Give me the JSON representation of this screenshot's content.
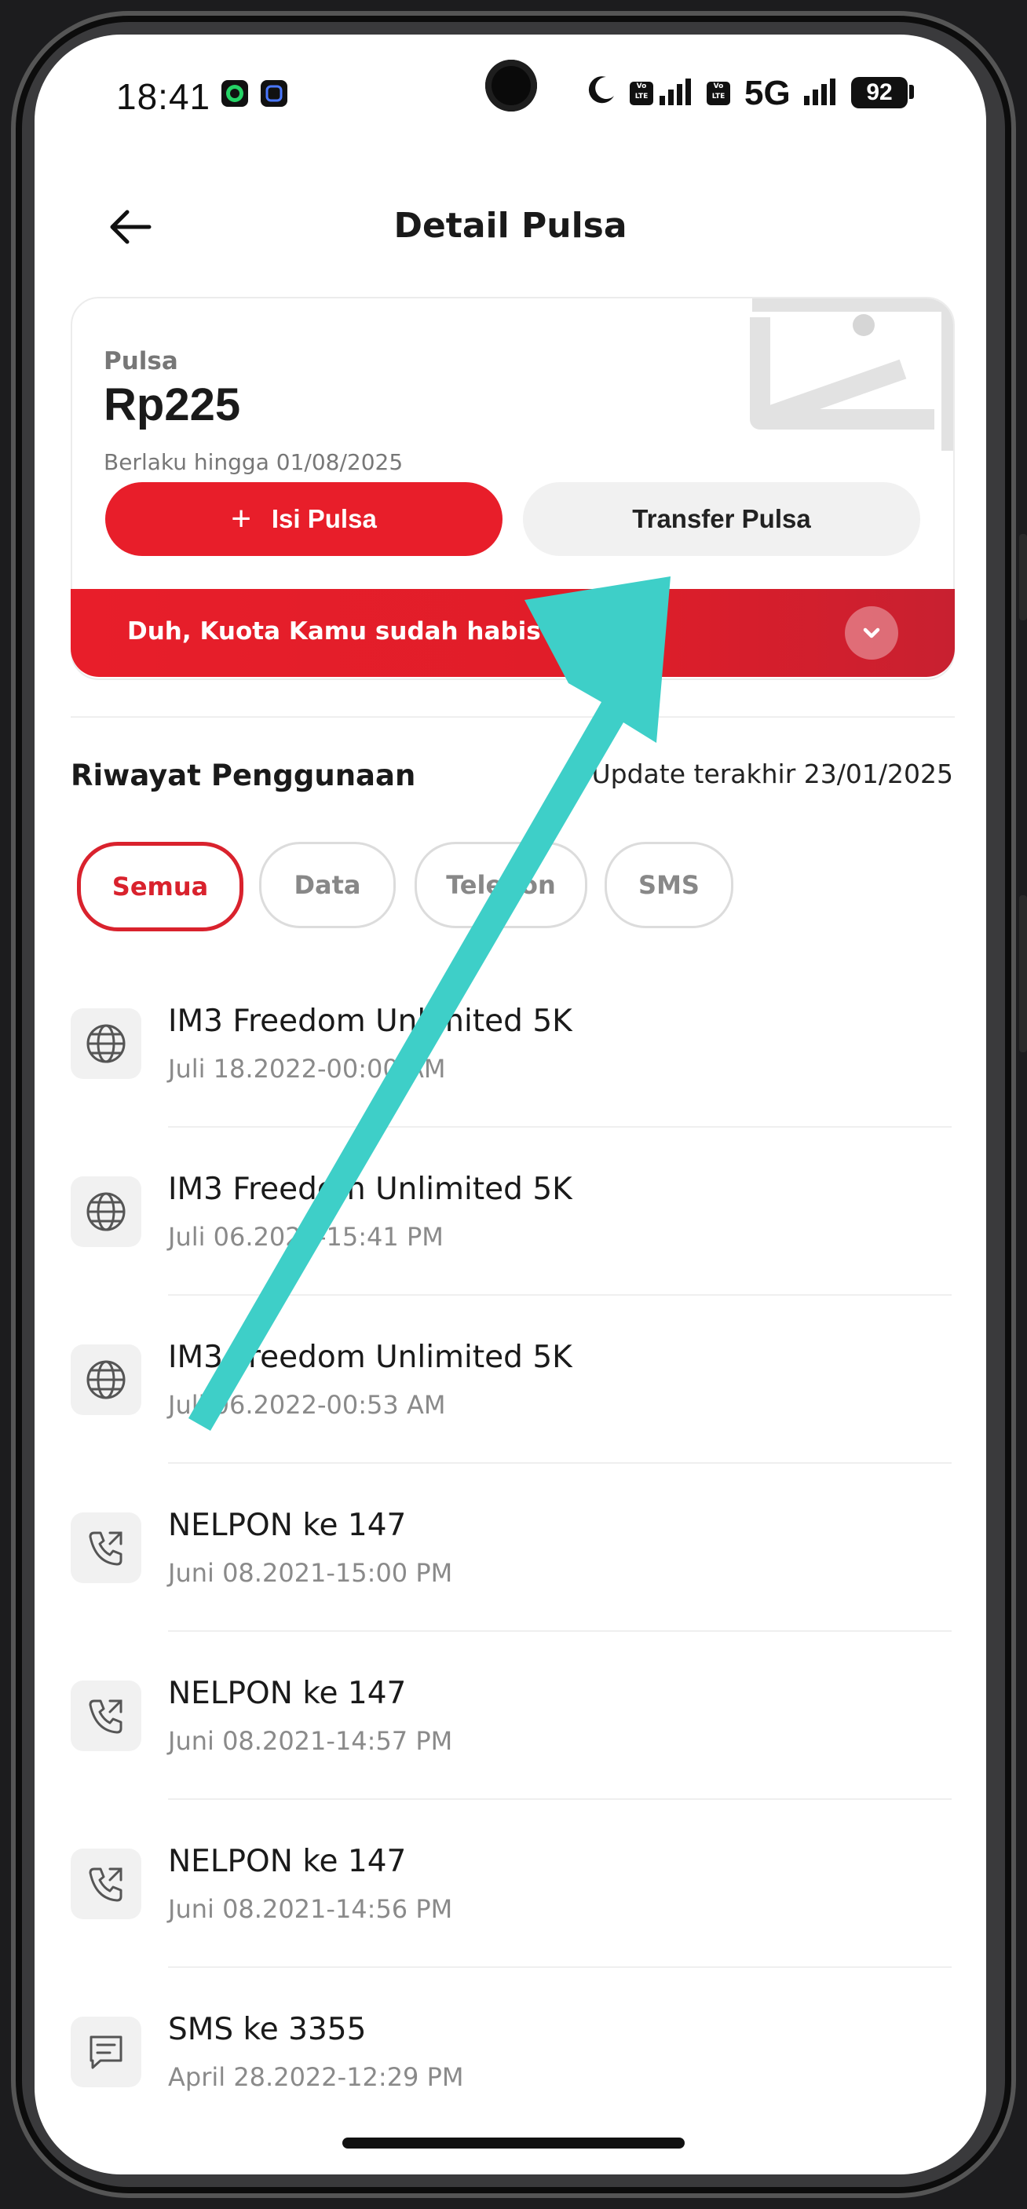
{
  "status_bar": {
    "time": "18:41",
    "network": "5G",
    "volte_label": "Vo LTE",
    "battery": "92"
  },
  "header": {
    "title": "Detail Pulsa"
  },
  "balance_card": {
    "label": "Pulsa",
    "amount": "Rp225",
    "validity": "Berlaku hingga 01/08/2025",
    "topup_label": "Isi Pulsa",
    "transfer_label": "Transfer Pulsa"
  },
  "alert": {
    "message": "Duh, Kuota Kamu sudah habis"
  },
  "history": {
    "title": "Riwayat Penggunaan",
    "updated": "Update terakhir 23/01/2025",
    "filters": [
      "Semua",
      "Data",
      "Telepon",
      "SMS"
    ],
    "active_filter": "Semua",
    "items": [
      {
        "icon": "globe-icon",
        "title": "IM3 Freedom Unlimited 5K",
        "date": "Juli 18.2022-00:00 AM"
      },
      {
        "icon": "globe-icon",
        "title": "IM3 Freedom Unlimited 5K",
        "date": "Juli 06.2022-15:41 PM"
      },
      {
        "icon": "globe-icon",
        "title": "IM3 Freedom Unlimited 5K",
        "date": "Juli 06.2022-00:53 AM"
      },
      {
        "icon": "phone-outgoing-icon",
        "title": "NELPON ke 147",
        "date": "Juni 08.2021-15:00 PM"
      },
      {
        "icon": "phone-outgoing-icon",
        "title": "NELPON ke 147",
        "date": "Juni 08.2021-14:57 PM"
      },
      {
        "icon": "phone-outgoing-icon",
        "title": "NELPON ke 147",
        "date": "Juni 08.2021-14:56 PM"
      },
      {
        "icon": "message-icon",
        "title": "SMS ke 3355",
        "date": "April 28.2022-12:29 PM"
      }
    ]
  },
  "colors": {
    "brand_red": "#e81e2a",
    "annotation_arrow": "#3ecfc8"
  }
}
